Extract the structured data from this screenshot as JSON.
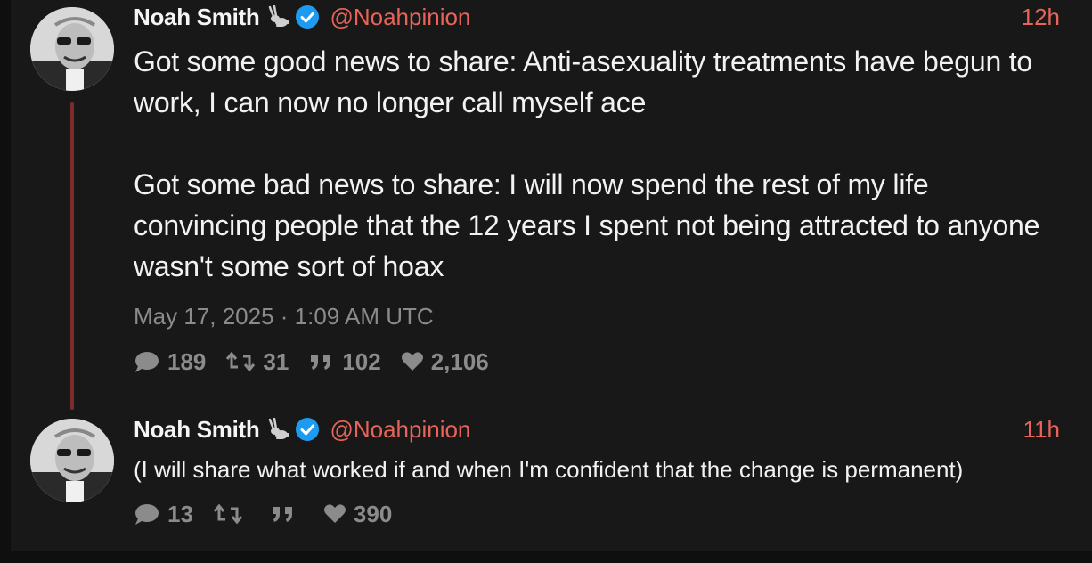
{
  "tweets": [
    {
      "name": "Noah Smith",
      "handle": "@Noahpinion",
      "time": "12h",
      "paragraphs": [
        "Got some good news to share: Anti-asexuality treatments have begun to work, I can now no longer call myself ace",
        "Got some bad news to share: I will now spend the rest of my life convincing people that the 12 years I spent not being attracted to anyone wasn't some sort of hoax"
      ],
      "date": "May 17, 2025 · 1:09 AM UTC",
      "stats": {
        "replies": "189",
        "retweets": "31",
        "quotes": "102",
        "likes": "2,106"
      }
    },
    {
      "name": "Noah Smith",
      "handle": "@Noahpinion",
      "time": "11h",
      "text": "(I will share what worked if and when I'm confident that the change is permanent)",
      "stats": {
        "replies": "13",
        "retweets": "",
        "quotes": "",
        "likes": "390"
      }
    }
  ],
  "colors": {
    "background": "#181818",
    "accent": "#e8645a",
    "muted": "#8b8b8b",
    "verified": "#1d9bf0",
    "thread_line": "#7a2d2a"
  },
  "icons": [
    "rabbit-icon",
    "verified-icon",
    "comment-icon",
    "retweet-icon",
    "quote-icon",
    "heart-icon"
  ]
}
